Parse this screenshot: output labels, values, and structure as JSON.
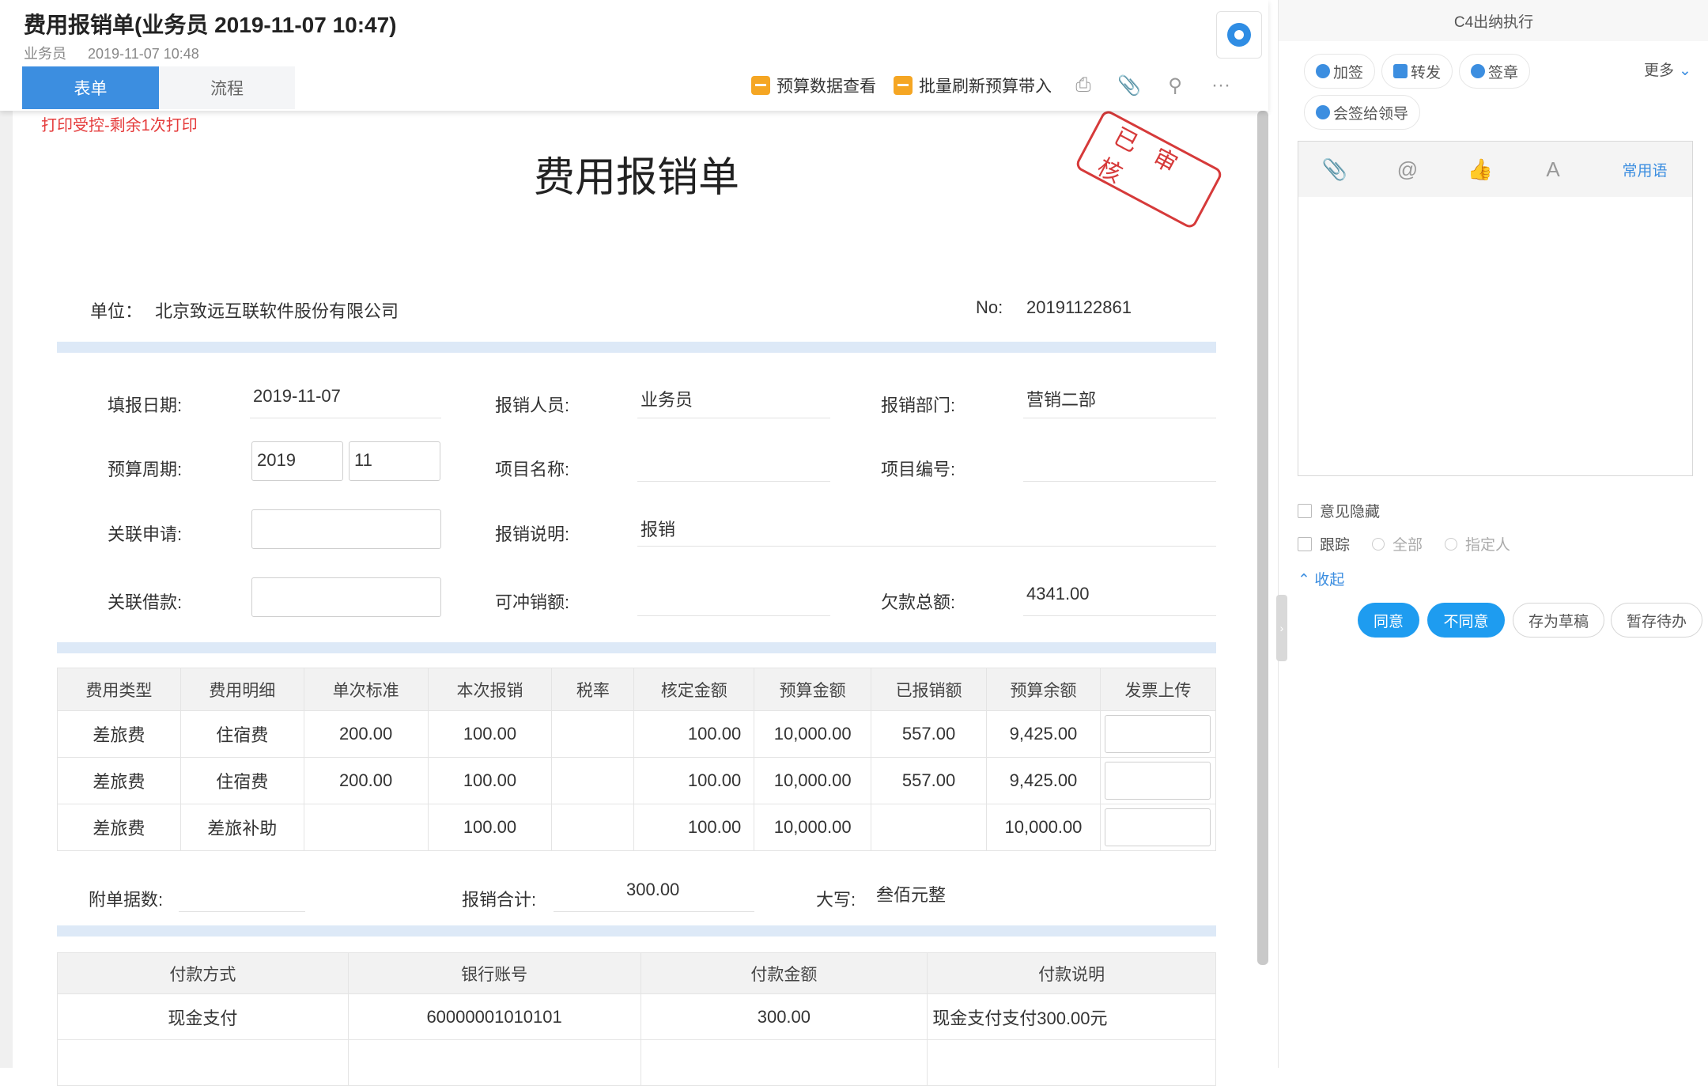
{
  "header": {
    "title": "费用报销单(业务员 2019-11-07 10:47)",
    "sub_user": "业务员",
    "sub_time": "2019-11-07 10:48",
    "tabs": [
      "表单",
      "流程"
    ],
    "toolbar": {
      "budget_view": "预算数据查看",
      "batch_refresh": "批量刷新预算带入",
      "print_icon": "printer-icon",
      "attach_icon": "paperclip-icon",
      "search_icon": "search-icon",
      "more": "···"
    }
  },
  "print_note": "打印受控-剩余1次打印",
  "form": {
    "title": "费用报销单",
    "stamp": "已审核",
    "unit_label": "单位：",
    "unit_value": "北京致远互联软件股份有限公司",
    "no_label": "No:",
    "no_value": "20191122861",
    "fields": {
      "fill_date_label": "填报日期:",
      "fill_date": "2019-11-07",
      "reimburser_label": "报销人员:",
      "reimburser": "业务员",
      "dept_label": "报销部门:",
      "dept": "营销二部",
      "budget_period_label": "预算周期:",
      "budget_year": "2019",
      "budget_month": "11",
      "project_name_label": "项目名称:",
      "project_name": "",
      "project_no_label": "项目编号:",
      "project_no": "",
      "related_apply_label": "关联申请:",
      "related_apply": "",
      "desc_label": "报销说明:",
      "desc": "报销",
      "related_loan_label": "关联借款:",
      "related_loan": "",
      "offset_label": "可冲销额:",
      "offset": "",
      "debt_total_label": "欠款总额:",
      "debt_total": "4341.00"
    },
    "expense_table": {
      "headers": [
        "费用类型",
        "费用明细",
        "单次标准",
        "本次报销",
        "税率",
        "核定金额",
        "预算金额",
        "已报销额",
        "预算余额",
        "发票上传"
      ],
      "rows": [
        [
          "差旅费",
          "住宿费",
          "200.00",
          "100.00",
          "",
          "100.00",
          "10,000.00",
          "557.00",
          "9,425.00",
          ""
        ],
        [
          "差旅费",
          "住宿费",
          "200.00",
          "100.00",
          "",
          "100.00",
          "10,000.00",
          "557.00",
          "9,425.00",
          ""
        ],
        [
          "差旅费",
          "差旅补助",
          "",
          "100.00",
          "",
          "100.00",
          "10,000.00",
          "",
          "10,000.00",
          ""
        ]
      ]
    },
    "summary": {
      "attach_count_label": "附单据数:",
      "attach_count": "",
      "total_label": "报销合计:",
      "total": "300.00",
      "capital_label": "大写:",
      "capital": "叁佰元整"
    },
    "pay_table": {
      "headers": [
        "付款方式",
        "银行账号",
        "付款金额",
        "付款说明"
      ],
      "rows": [
        [
          "现金支付",
          "60000001010101",
          "300.00",
          "现金支付支付300.00元"
        ]
      ]
    }
  },
  "right_panel": {
    "title": "C4出纳执行",
    "actions": [
      "加签",
      "转发",
      "签章",
      "会签给领导"
    ],
    "more": "更多",
    "editor_common": "常用语",
    "opinion_hidden": "意见隐藏",
    "track": "跟踪",
    "track_all": "全部",
    "track_specified": "指定人",
    "collapse": "收起",
    "buttons": {
      "agree": "同意",
      "disagree": "不同意",
      "save_draft": "存为草稿",
      "hold": "暂存待办"
    }
  },
  "colors": {
    "accent": "#3c8ee0",
    "stamp": "#d63a3a",
    "primary_button": "#1e9cf0",
    "warning": "#e53c3c"
  }
}
